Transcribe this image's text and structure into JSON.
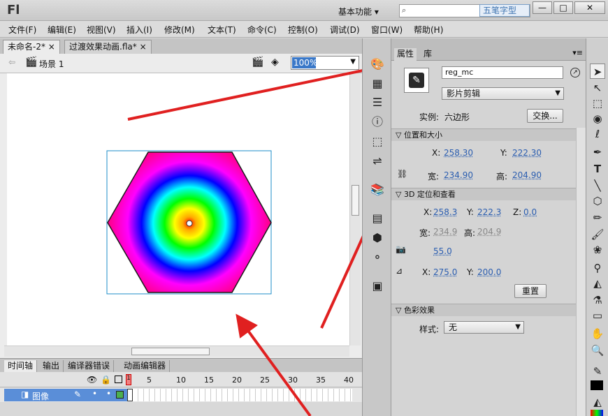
{
  "app": {
    "logo": "Fl",
    "workspace": "基本功能",
    "watermark": "五笔字型"
  },
  "window_buttons": [
    "—",
    "□",
    "✕"
  ],
  "menu": [
    "文件(F)",
    "编辑(E)",
    "视图(V)",
    "插入(I)",
    "修改(M)",
    "文本(T)",
    "命令(C)",
    "控制(O)",
    "调试(D)",
    "窗口(W)",
    "帮助(H)"
  ],
  "doc_tabs": [
    {
      "label": "未命名-2*",
      "close": "×"
    },
    {
      "label": "过渡效果动画.fla*",
      "close": "×"
    }
  ],
  "scene": {
    "label": "场景 1",
    "zoom": "100%"
  },
  "timeline": {
    "tabs": [
      "时间轴",
      "输出",
      "编译器错误",
      "动画编辑器"
    ],
    "frame_numbers": [
      "1",
      "5",
      "10",
      "15",
      "20",
      "25",
      "30",
      "35",
      "40"
    ],
    "layer_name": "图像"
  },
  "properties": {
    "tabs": [
      "属性",
      "库"
    ],
    "instance_name": "reg_mc",
    "type": "影片剪辑",
    "instance_label": "实例:",
    "instance_of": "六边形",
    "swap_button": "交换...",
    "pos_size": {
      "title": "位置和大小",
      "x_label": "X:",
      "x": "258.30",
      "y_label": "Y:",
      "y": "222.30",
      "w_label": "宽:",
      "w": "234.90",
      "h_label": "高:",
      "h": "204.90"
    },
    "threed": {
      "title": "3D 定位和查看",
      "x_label": "X:",
      "x": "258.3",
      "y_label": "Y:",
      "y": "222.3",
      "z_label": "Z:",
      "z": "0.0",
      "w_label": "宽:",
      "w": "234.9",
      "h_label": "高:",
      "h": "204.9",
      "perspective": "55.0",
      "vx_label": "X:",
      "vx": "275.0",
      "vy_label": "Y:",
      "vy": "200.0",
      "reset": "重置"
    },
    "color_effect": {
      "title": "色彩效果",
      "style_label": "样式:",
      "style": "无"
    }
  },
  "colors": {
    "annotation": "#e02020",
    "accent": "#3a78c8"
  }
}
